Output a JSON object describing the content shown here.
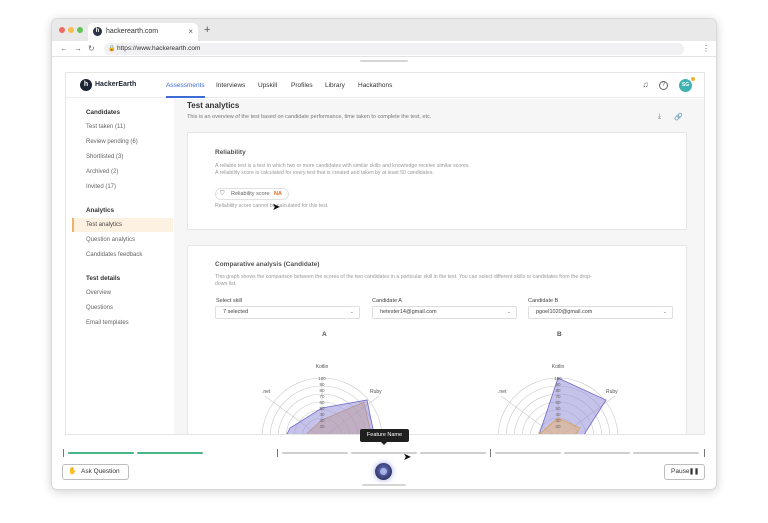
{
  "browser": {
    "tab_title": "hackerearth.com",
    "tab_close": "×",
    "new_tab": "+",
    "url": "https://www.hackerearth.com"
  },
  "app": {
    "logo_text": "HackerEarth",
    "logo_mark": "h",
    "avatar_initials": "SG",
    "nav": [
      "Assessments",
      "Interviews",
      "Upskill",
      "Profiles",
      "Library",
      "Hackathons"
    ]
  },
  "sidebar": {
    "candidates_heading": "Candidates",
    "candidates_items": [
      "Test taken (11)",
      "Review pending (6)",
      "Shortlisted (3)",
      "Archived (2)",
      "Invited (17)"
    ],
    "analytics_heading": "Analytics",
    "analytics_items": [
      "Test analytics",
      "Question analytics",
      "Candidates feedback"
    ],
    "details_heading": "Test details",
    "details_items": [
      "Overview",
      "Questions",
      "Email templates"
    ]
  },
  "page": {
    "title": "Test analytics",
    "subtitle": "This is an overview of the test based on candidate performance, time taken to complete the test, etc."
  },
  "reliability": {
    "title": "Reliability",
    "line1": "A reliable test is a test in which two or more candidates with similar skills and knowledge receive similar scores.",
    "line2": "A reliability score is calculated for every test that is created and taken by at least 50 candidates.",
    "score_label": "Reliability score",
    "score_value": "NA",
    "note": "Reliability score cannot be calculated for this test."
  },
  "comparative": {
    "title": "Comparative analysis (Candidate)",
    "desc1": "This graph shows the comparison between the scores of the two candidates in a particular skill in the test. You can select different skills or candidates from the drop-",
    "desc2": "down list.",
    "skill_label": "Select skill",
    "skill_value": "7 selected",
    "cand_a_label": "Candidate A",
    "cand_a_value": "hetester14@gmail.com",
    "cand_b_label": "Candidate B",
    "cand_b_value": "pgoel1020@gmail.com",
    "radar_a_title": "A",
    "radar_b_title": "B",
    "axis_top": "Kotlin",
    "axis_right": "Ruby",
    "axis_left": ".net",
    "scale": [
      "100",
      "90",
      "80",
      "70",
      "60",
      "50",
      "40",
      "30",
      "20"
    ]
  },
  "recorder": {
    "tooltip": "Feature Name",
    "ask_button": "Ask Question",
    "pause_button": "Pause",
    "pause_glyph": "❚❚"
  },
  "colors": {
    "accent": "#3f6bd6",
    "progress_done": "#4bb58a",
    "sidebar_active_bg": "#fdf1e2",
    "na_orange": "#e06d2b",
    "radar_purple": "#8d88d8",
    "radar_orange": "#e8b26a"
  }
}
